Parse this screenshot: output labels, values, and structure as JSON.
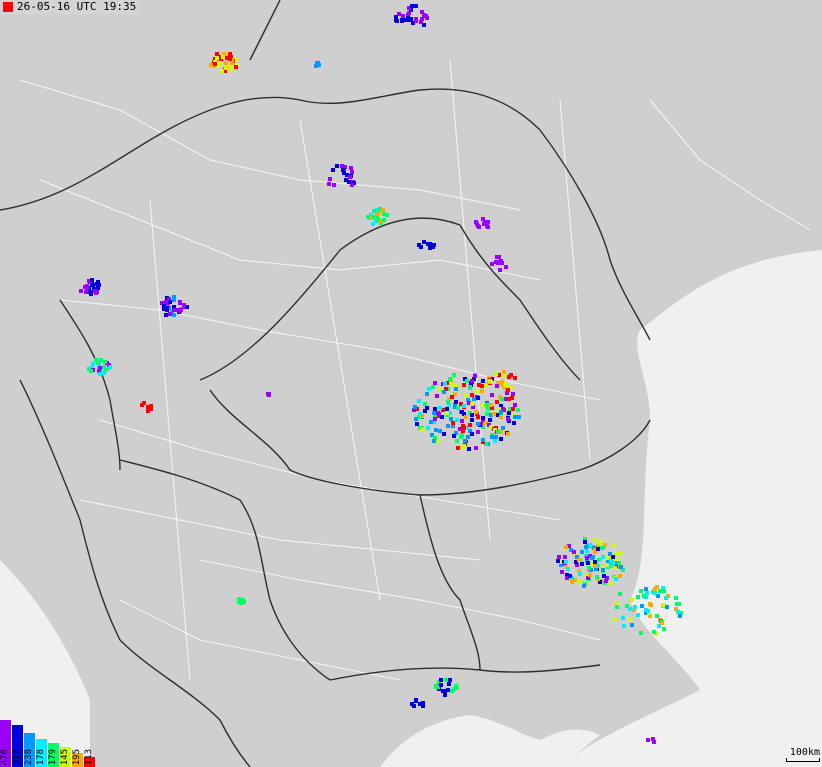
{
  "map": {
    "timestamp": "26-05-16 UTC 19:35",
    "timestamp_marker_color": "#ff0000",
    "scale_label": "100km",
    "colors": {
      "land": "#c8c8c8",
      "sea": "#f0f0f0",
      "border": "#2e2e2e",
      "road": "#ffffff"
    },
    "legend": [
      {
        "label": "476",
        "color": "#9900ff"
      },
      {
        "label": "317",
        "color": "#0000dd"
      },
      {
        "label": "238",
        "color": "#0099ff"
      },
      {
        "label": "178",
        "color": "#00eeff"
      },
      {
        "label": "179",
        "color": "#00ff66"
      },
      {
        "label": "145",
        "color": "#ccff00"
      },
      {
        "label": "195",
        "color": "#ffaa00"
      },
      {
        "label": "113",
        "color": "#ff0000"
      }
    ]
  }
}
